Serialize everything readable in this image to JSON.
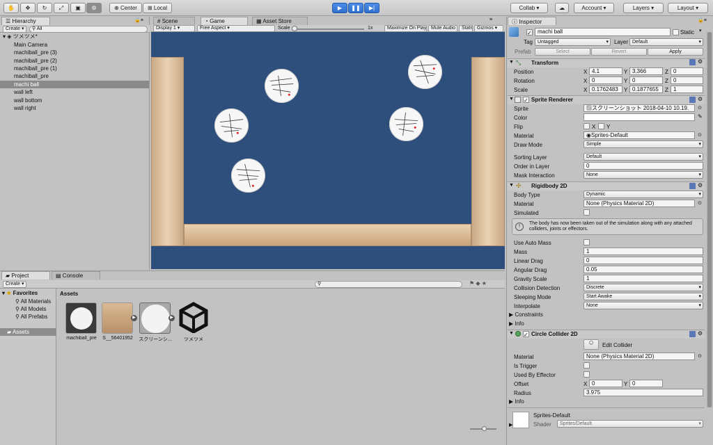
{
  "toolbar": {
    "tools": [
      "hand-icon",
      "move-icon",
      "rotate-icon",
      "scale-icon",
      "rect-icon",
      "transform-icon"
    ],
    "center": "Center",
    "local": "Local",
    "collab": "Collab ▾",
    "account": "Account",
    "layers": "Layers",
    "layout": "Layout"
  },
  "hierarchy": {
    "tab": "Hierarchy",
    "create": "Create",
    "search": "All",
    "scene": "ツメツメ*",
    "items": [
      "Main Camera",
      "machiball_pre (3)",
      "machiball_pre (2)",
      "machiball_pre (1)",
      "machiball_pre",
      "machi ball",
      "wall left",
      "wall bottom",
      "wall right"
    ],
    "selected_index": 5
  },
  "tabs": {
    "scene": "Scene",
    "game": "Game",
    "asset_store": "Asset Store"
  },
  "game_bar": {
    "display": "Display 1",
    "aspect": "Free Aspect",
    "scale_label": "Scale",
    "scale_value": "1x",
    "maximize": "Maximize On Play",
    "mute": "Mute Audio",
    "stats": "Stats",
    "gizmos": "Gizmos"
  },
  "project": {
    "tab": "Project",
    "console": "Console",
    "create": "Create",
    "favorites": "Favorites",
    "fav_items": [
      "All Materials",
      "All Models",
      "All Prefabs"
    ],
    "assets_root": "Assets",
    "breadcrumb": "Assets",
    "assets": [
      "machiball_pre",
      "S__56401952",
      "スクリーンシ...",
      "ツメツメ"
    ]
  },
  "inspector": {
    "tab": "Inspector",
    "name": "machi ball",
    "static": "Static",
    "tag_label": "Tag",
    "tag": "Untagged",
    "layer_label": "Layer",
    "layer": "Default",
    "prefab_label": "Prefab",
    "prefab_select": "Select",
    "prefab_revert": "Revert",
    "prefab_apply": "Apply",
    "transform": {
      "title": "Transform",
      "position_label": "Position",
      "rotation_label": "Rotation",
      "scale_label": "Scale",
      "pos": [
        "4.1",
        "3.366",
        "0"
      ],
      "rot": [
        "0",
        "0",
        "0"
      ],
      "scale": [
        "0.1762483",
        "0.1877655",
        "1"
      ]
    },
    "sprite_renderer": {
      "title": "Sprite Renderer",
      "sprite_label": "Sprite",
      "sprite": "スクリーンショット 2018-04-10 10.19.",
      "color_label": "Color",
      "flip_label": "Flip",
      "flip_x": "X",
      "flip_y": "Y",
      "material_label": "Material",
      "material": "Sprites-Default",
      "draw_mode_label": "Draw Mode",
      "draw_mode": "Simple",
      "sorting_layer_label": "Sorting Layer",
      "sorting_layer": "Default",
      "order_label": "Order in Layer",
      "order": "0",
      "mask_label": "Mask Interaction",
      "mask": "None"
    },
    "rigidbody": {
      "title": "Rigidbody 2D",
      "body_type_label": "Body Type",
      "body_type": "Dynamic",
      "material_label": "Material",
      "material": "None (Physics Material 2D)",
      "simulated_label": "Simulated",
      "info": "The body has now been taken out of the simulation along with any attached colliders, joints or effectors.",
      "auto_mass_label": "Use Auto Mass",
      "mass_label": "Mass",
      "mass": "1",
      "linear_drag_label": "Linear Drag",
      "linear_drag": "0",
      "angular_drag_label": "Angular Drag",
      "angular_drag": "0.05",
      "gravity_label": "Gravity Scale",
      "gravity": "1",
      "collision_label": "Collision Detection",
      "collision": "Discrete",
      "sleeping_label": "Sleeping Mode",
      "sleeping": "Start Awake",
      "interpolate_label": "Interpolate",
      "interpolate": "None",
      "constraints": "Constraints",
      "info_fold": "Info"
    },
    "circle_collider": {
      "title": "Circle Collider 2D",
      "edit": "Edit Collider",
      "material_label": "Material",
      "material": "None (Physics Material 2D)",
      "trigger_label": "Is Trigger",
      "effector_label": "Used By Effector",
      "offset_label": "Offset",
      "offset": [
        "0",
        "0"
      ],
      "radius_label": "Radius",
      "radius": "3.975",
      "info_fold": "Info"
    },
    "material_preview": {
      "name": "Sprites-Default",
      "shader_label": "Shader",
      "shader": "Sprites/Default"
    }
  },
  "axis": {
    "x": "X",
    "y": "Y",
    "z": "Z"
  }
}
